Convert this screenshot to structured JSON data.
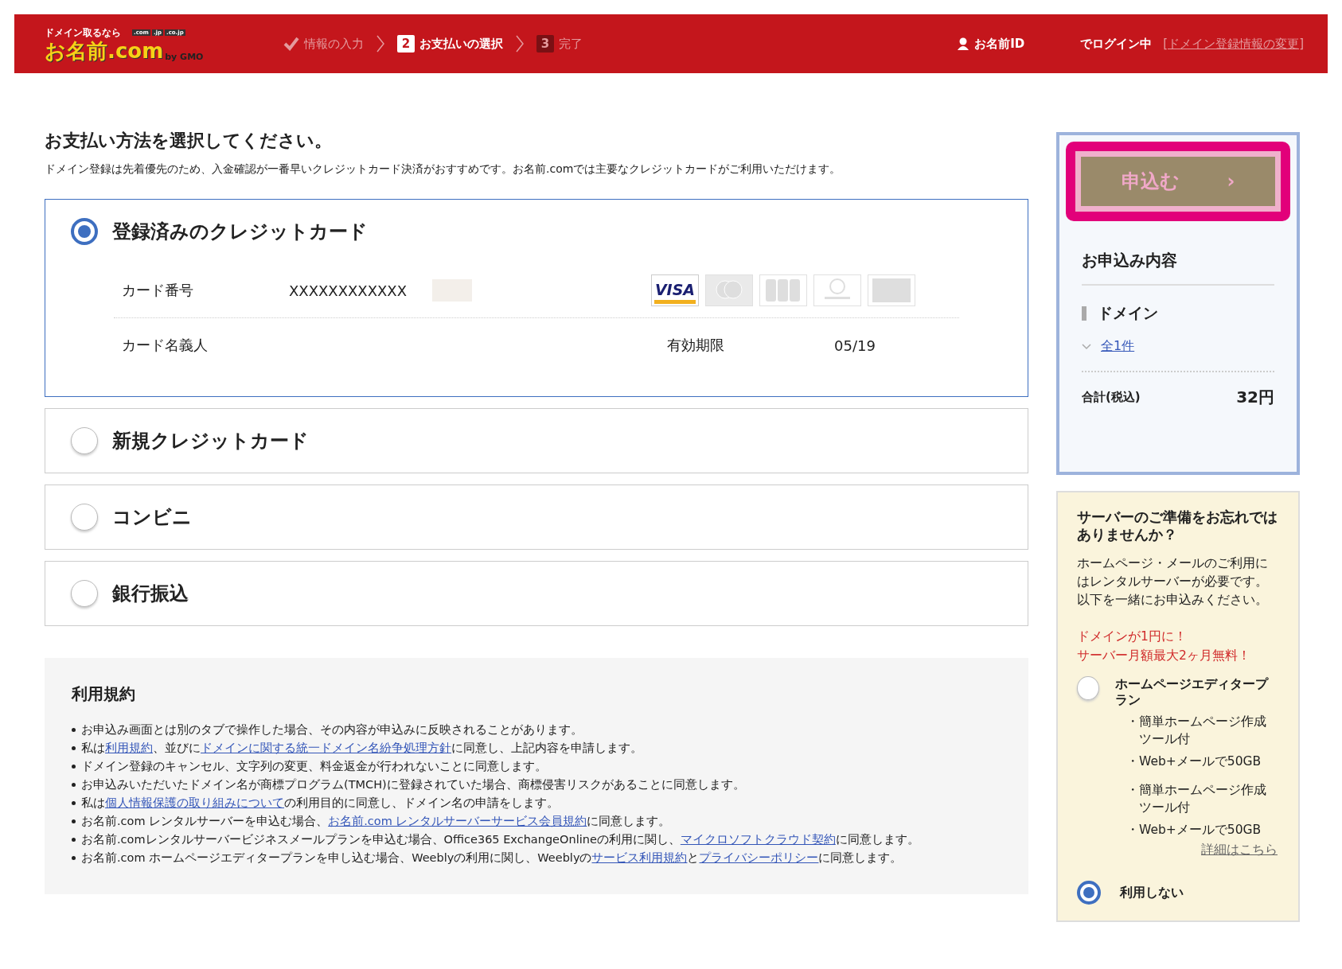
{
  "header": {
    "logo": {
      "tagline": "ドメイン取るなら",
      "tlds": [
        ".com",
        ".jp",
        ".co.jp"
      ],
      "name": "お名前.com",
      "by": "by GMO"
    },
    "steps": [
      {
        "label": "情報の入力",
        "done": true,
        "selected": false
      },
      {
        "number": "2",
        "label": "お支払いの選択",
        "done": false,
        "selected": true
      },
      {
        "number": "3",
        "label": "完了",
        "done": false,
        "selected": false
      }
    ],
    "user": {
      "id_label": "お名前ID",
      "login_text": "でログイン中",
      "change_link": "[ドメイン登録情報の変更]"
    }
  },
  "main": {
    "title": "お支払い方法を選択してください。",
    "description": "ドメイン登録は先着優先のため、入金確認が一番早いクレジットカード決済がおすすめです。お名前.comでは主要なクレジットカードがご利用いただけます。",
    "methods": [
      {
        "label": "登録済みのクレジットカード",
        "selected": true,
        "kind": "saved_card",
        "details": {
          "number_label": "カード番号",
          "number": "XXXXXXXXXXXX",
          "holder_label": "カード名義人",
          "expiry_label": "有効期限",
          "expiry": "05/19",
          "brands": [
            {
              "kind": "visa",
              "label": "VISA",
              "active": true
            },
            {
              "kind": "mastercard",
              "active": false
            },
            {
              "kind": "jcb",
              "active": false
            },
            {
              "kind": "diners",
              "active": false
            },
            {
              "kind": "amex",
              "active": false
            }
          ]
        }
      },
      {
        "label": "新規クレジットカード",
        "selected": false,
        "kind": "plain"
      },
      {
        "label": "コンビニ",
        "selected": false,
        "kind": "plain"
      },
      {
        "label": "銀行振込",
        "selected": false,
        "kind": "plain"
      }
    ],
    "terms": {
      "title": "利用規約",
      "items": [
        [
          {
            "text": "お申込み画面とは別のタブで操作した場合、その内容が申込みに反映されることがあります。",
            "link": false
          }
        ],
        [
          {
            "text": "私は",
            "link": false
          },
          {
            "text": "利用規約",
            "link": true
          },
          {
            "text": "、並びに",
            "link": false
          },
          {
            "text": "ドメインに関する統一ドメイン名紛争処理方針",
            "link": true
          },
          {
            "text": "に同意し、上記内容を申請します。",
            "link": false
          }
        ],
        [
          {
            "text": "ドメイン登録のキャンセル、文字列の変更、料金返金が行われないことに同意します。",
            "link": false
          }
        ],
        [
          {
            "text": "お申込みいただいたドメイン名が商標プログラム(TMCH)に登録されていた場合、商標侵害リスクがあることに同意します。",
            "link": false
          }
        ],
        [
          {
            "text": "私は",
            "link": false
          },
          {
            "text": "個人情報保護の取り組みについて",
            "link": true
          },
          {
            "text": "の利用目的に同意し、ドメイン名の申請をします。",
            "link": false
          }
        ],
        [
          {
            "text": "お名前.com レンタルサーバーを申込む場合、",
            "link": false
          },
          {
            "text": "お名前.com レンタルサーバーサービス会員規約",
            "link": true
          },
          {
            "text": "に同意します。",
            "link": false
          }
        ],
        [
          {
            "text": "お名前.comレンタルサーバービジネスメールプランを申込む場合、Office365 ExchangeOnlineの利用に関し、",
            "link": false
          },
          {
            "text": "マイクロソフトクラウド契約",
            "link": true
          },
          {
            "text": "に同意します。",
            "link": false
          }
        ],
        [
          {
            "text": "お名前.com ホームページエディタープランを申し込む場合、Weeblyの利用に関し、Weeblyの",
            "link": false
          },
          {
            "text": "サービス利用規約",
            "link": true
          },
          {
            "text": "と",
            "link": false
          },
          {
            "text": "プライバシーポリシー",
            "link": true
          },
          {
            "text": "に同意します。",
            "link": false
          }
        ]
      ]
    }
  },
  "sidebar": {
    "apply_button": "申込む",
    "apply_arrow": "›",
    "summary": {
      "title": "お申込み内容",
      "section": "ドメイン",
      "count_link": "全1件",
      "total_label": "合計(税込)",
      "total": "32円"
    },
    "server": {
      "title": "サーバーのご準備をお忘れではありませんか？",
      "text": "ホームページ・メールのご利用にはレンタルサーバーが必要です。以下を一緒にお申込みください。",
      "promo": [
        "ドメインが1円に！",
        "サーバー月額最大2ヶ月無料！"
      ],
      "plans": [
        {
          "name": "ホームページエディタープラン",
          "selected": false,
          "features": [
            {
              "bullet": "・",
              "text": "簡単ホームページ作成ツール付"
            },
            {
              "bullet": "・",
              "text": "Web+メールで50GB"
            }
          ]
        },
        {
          "features": [
            {
              "bullet": "・",
              "text": "簡単ホームページ作成ツール付"
            },
            {
              "bullet": "・",
              "text": "Web+メールで50GB"
            }
          ],
          "link": "詳細はこちら"
        }
      ],
      "none_option": {
        "label": "利用しない",
        "selected": true
      }
    }
  }
}
